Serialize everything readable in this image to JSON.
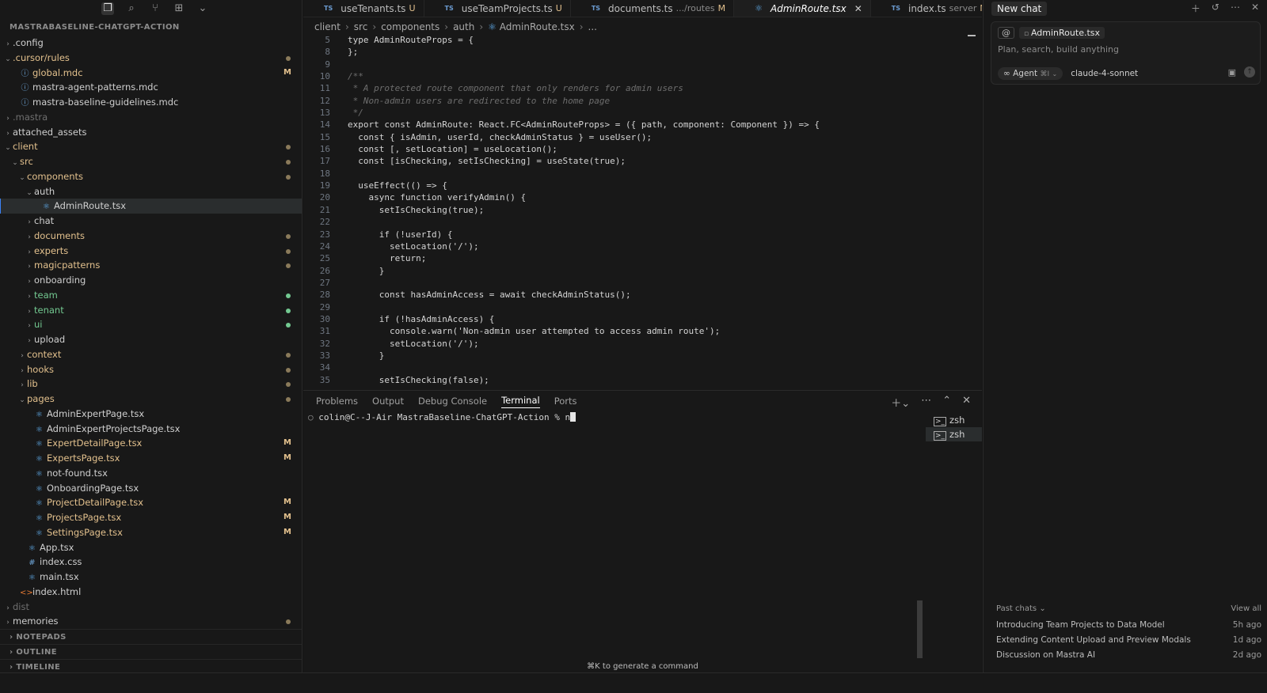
{
  "explorer": {
    "root_label": "MASTRABASELINE-CHATGPT-ACTION",
    "items": [
      {
        "label": ".config",
        "depth": 0,
        "kind": "folder",
        "open": false,
        "tone": "normal"
      },
      {
        "label": ".cursor/rules",
        "depth": 0,
        "kind": "folder",
        "open": true,
        "tone": "mod",
        "dot": "mod"
      },
      {
        "label": "global.mdc",
        "depth": 1,
        "kind": "file",
        "icon": "info",
        "tone": "mod",
        "badge": "M"
      },
      {
        "label": "mastra-agent-patterns.mdc",
        "depth": 1,
        "kind": "file",
        "icon": "info",
        "tone": "normal"
      },
      {
        "label": "mastra-baseline-guidelines.mdc",
        "depth": 1,
        "kind": "file",
        "icon": "info",
        "tone": "normal"
      },
      {
        "label": ".mastra",
        "depth": 0,
        "kind": "folder",
        "open": false,
        "tone": "dim"
      },
      {
        "label": "attached_assets",
        "depth": 0,
        "kind": "folder",
        "open": false,
        "tone": "normal"
      },
      {
        "label": "client",
        "depth": 0,
        "kind": "folder",
        "open": true,
        "tone": "mod",
        "dot": "mod"
      },
      {
        "label": "src",
        "depth": 1,
        "kind": "folder",
        "open": true,
        "tone": "mod",
        "dot": "mod"
      },
      {
        "label": "components",
        "depth": 2,
        "kind": "folder",
        "open": true,
        "tone": "mod",
        "dot": "mod"
      },
      {
        "label": "auth",
        "depth": 3,
        "kind": "folder",
        "open": true,
        "tone": "normal"
      },
      {
        "label": "AdminRoute.tsx",
        "depth": 4,
        "kind": "file",
        "icon": "react",
        "tone": "normal",
        "selected": true
      },
      {
        "label": "chat",
        "depth": 3,
        "kind": "folder",
        "open": false,
        "tone": "normal"
      },
      {
        "label": "documents",
        "depth": 3,
        "kind": "folder",
        "open": false,
        "tone": "mod",
        "dot": "mod"
      },
      {
        "label": "experts",
        "depth": 3,
        "kind": "folder",
        "open": false,
        "tone": "mod",
        "dot": "mod"
      },
      {
        "label": "magicpatterns",
        "depth": 3,
        "kind": "folder",
        "open": false,
        "tone": "mod",
        "dot": "mod"
      },
      {
        "label": "onboarding",
        "depth": 3,
        "kind": "folder",
        "open": false,
        "tone": "normal"
      },
      {
        "label": "team",
        "depth": 3,
        "kind": "folder",
        "open": false,
        "tone": "grn",
        "dot": "grn"
      },
      {
        "label": "tenant",
        "depth": 3,
        "kind": "folder",
        "open": false,
        "tone": "grn",
        "dot": "grn"
      },
      {
        "label": "ui",
        "depth": 3,
        "kind": "folder",
        "open": false,
        "tone": "grn",
        "dot": "grn"
      },
      {
        "label": "upload",
        "depth": 3,
        "kind": "folder",
        "open": false,
        "tone": "normal"
      },
      {
        "label": "context",
        "depth": 2,
        "kind": "folder",
        "open": false,
        "tone": "mod",
        "dot": "mod"
      },
      {
        "label": "hooks",
        "depth": 2,
        "kind": "folder",
        "open": false,
        "tone": "mod",
        "dot": "mod"
      },
      {
        "label": "lib",
        "depth": 2,
        "kind": "folder",
        "open": false,
        "tone": "mod",
        "dot": "mod"
      },
      {
        "label": "pages",
        "depth": 2,
        "kind": "folder",
        "open": true,
        "tone": "mod",
        "dot": "mod"
      },
      {
        "label": "AdminExpertPage.tsx",
        "depth": 3,
        "kind": "file",
        "icon": "react",
        "tone": "normal"
      },
      {
        "label": "AdminExpertProjectsPage.tsx",
        "depth": 3,
        "kind": "file",
        "icon": "react",
        "tone": "normal"
      },
      {
        "label": "ExpertDetailPage.tsx",
        "depth": 3,
        "kind": "file",
        "icon": "react",
        "tone": "mod",
        "badge": "M"
      },
      {
        "label": "ExpertsPage.tsx",
        "depth": 3,
        "kind": "file",
        "icon": "react",
        "tone": "mod",
        "badge": "M"
      },
      {
        "label": "not-found.tsx",
        "depth": 3,
        "kind": "file",
        "icon": "react",
        "tone": "normal"
      },
      {
        "label": "OnboardingPage.tsx",
        "depth": 3,
        "kind": "file",
        "icon": "react",
        "tone": "normal"
      },
      {
        "label": "ProjectDetailPage.tsx",
        "depth": 3,
        "kind": "file",
        "icon": "react",
        "tone": "mod",
        "badge": "M"
      },
      {
        "label": "ProjectsPage.tsx",
        "depth": 3,
        "kind": "file",
        "icon": "react",
        "tone": "mod",
        "badge": "M"
      },
      {
        "label": "SettingsPage.tsx",
        "depth": 3,
        "kind": "file",
        "icon": "react",
        "tone": "mod",
        "badge": "M"
      },
      {
        "label": "App.tsx",
        "depth": 2,
        "kind": "file",
        "icon": "react",
        "tone": "normal"
      },
      {
        "label": "index.css",
        "depth": 2,
        "kind": "file",
        "icon": "hash",
        "tone": "normal"
      },
      {
        "label": "main.tsx",
        "depth": 2,
        "kind": "file",
        "icon": "react",
        "tone": "normal"
      },
      {
        "label": "index.html",
        "depth": 1,
        "kind": "file",
        "icon": "html",
        "tone": "normal"
      },
      {
        "label": "dist",
        "depth": 0,
        "kind": "folder",
        "open": false,
        "tone": "dim"
      },
      {
        "label": "memories",
        "depth": 0,
        "kind": "folder",
        "open": false,
        "tone": "normal",
        "dot": "mod"
      }
    ],
    "sections": [
      "NOTEPADS",
      "OUTLINE",
      "TIMELINE"
    ]
  },
  "tabs": [
    {
      "label": "useTenants.ts",
      "flag": "U",
      "sub": "",
      "active": false
    },
    {
      "label": "useTeamProjects.ts",
      "flag": "U",
      "sub": "",
      "active": false
    },
    {
      "label": "documents.ts",
      "flag": "M",
      "sub": ".../routes",
      "active": false
    },
    {
      "label": "AdminRoute.tsx",
      "flag": "",
      "sub": "",
      "active": true
    },
    {
      "label": "index.ts",
      "flag": "M",
      "sub": "server",
      "active": false
    }
  ],
  "tab_file_badge": "TS",
  "breadcrumb": [
    "client",
    "src",
    "components",
    "auth",
    "AdminRoute.tsx",
    "..."
  ],
  "code_lines": [
    {
      "n": "5",
      "t": "type AdminRouteProps = {"
    },
    {
      "n": "8",
      "t": "};"
    },
    {
      "n": "9",
      "t": ""
    },
    {
      "n": "10",
      "t": "/**"
    },
    {
      "n": "11",
      "t": " * A protected route component that only renders for admin users"
    },
    {
      "n": "12",
      "t": " * Non-admin users are redirected to the home page"
    },
    {
      "n": "13",
      "t": " */"
    },
    {
      "n": "14",
      "t": "export const AdminRoute: React.FC<AdminRouteProps> = ({ path, component: Component }) => {"
    },
    {
      "n": "15",
      "t": "  const { isAdmin, userId, checkAdminStatus } = useUser();"
    },
    {
      "n": "16",
      "t": "  const [, setLocation] = useLocation();"
    },
    {
      "n": "17",
      "t": "  const [isChecking, setIsChecking] = useState(true);"
    },
    {
      "n": "18",
      "t": ""
    },
    {
      "n": "19",
      "t": "  useEffect(() => {"
    },
    {
      "n": "20",
      "t": "    async function verifyAdmin() {"
    },
    {
      "n": "21",
      "t": "      setIsChecking(true);"
    },
    {
      "n": "22",
      "t": ""
    },
    {
      "n": "23",
      "t": "      if (!userId) {"
    },
    {
      "n": "24",
      "t": "        setLocation('/');"
    },
    {
      "n": "25",
      "t": "        return;"
    },
    {
      "n": "26",
      "t": "      }"
    },
    {
      "n": "27",
      "t": ""
    },
    {
      "n": "28",
      "t": "      const hasAdminAccess = await checkAdminStatus();"
    },
    {
      "n": "29",
      "t": ""
    },
    {
      "n": "30",
      "t": "      if (!hasAdminAccess) {"
    },
    {
      "n": "31",
      "t": "        console.warn('Non-admin user attempted to access admin route');"
    },
    {
      "n": "32",
      "t": "        setLocation('/');"
    },
    {
      "n": "33",
      "t": "      }"
    },
    {
      "n": "34",
      "t": ""
    },
    {
      "n": "35",
      "t": "      setIsChecking(false);"
    }
  ],
  "panel": {
    "tabs": [
      "Problems",
      "Output",
      "Debug Console",
      "Terminal",
      "Ports"
    ],
    "active_tab": "Terminal",
    "prompt": "colin@C--J-Air MastraBaseline-ChatGPT-Action % n",
    "terminals": [
      "zsh",
      "zsh"
    ],
    "hint": "⌘K to generate a command"
  },
  "chat": {
    "new_chat_label": "New chat",
    "context_at": "@",
    "context_file": "AdminRoute.tsx",
    "placeholder": "Plan, search, build anything",
    "agent_label": "Agent",
    "agent_shortcut": "⌘I",
    "model": "claude-4-sonnet",
    "past_label": "Past chats",
    "view_all": "View all",
    "past": [
      {
        "title": "Introducing Team Projects to Data Model",
        "when": "5h ago"
      },
      {
        "title": "Extending Content Upload and Preview Modals",
        "when": "1d ago"
      },
      {
        "title": "Discussion on Mastra AI",
        "when": "2d ago"
      }
    ]
  },
  "colors": {
    "accent": "#3b82f6",
    "modified": "#e2c08d",
    "untracked": "#73c991"
  }
}
